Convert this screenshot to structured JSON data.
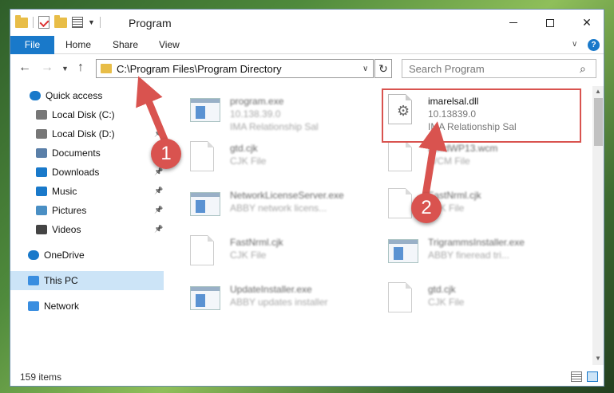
{
  "window": {
    "title": "Program"
  },
  "controls": {
    "minimize": "—",
    "maximize": "☐",
    "close": "✕"
  },
  "ribbon": {
    "tabs": [
      "File",
      "Home",
      "Share",
      "View"
    ],
    "help": "?"
  },
  "navigation": {
    "address": "C:\\Program Files\\Program Directory",
    "search_placeholder": "Search Program"
  },
  "sidebar": {
    "items": [
      {
        "label": "Quick access",
        "icon": "star-icon",
        "pinned": false
      },
      {
        "label": "Local Disk (C:)",
        "icon": "drive-icon",
        "pinned": false
      },
      {
        "label": "Local Disk (D:)",
        "icon": "drive-icon",
        "pinned": true
      },
      {
        "label": "Documents",
        "icon": "documents-icon",
        "pinned": true
      },
      {
        "label": "Downloads",
        "icon": "download-icon",
        "pinned": true
      },
      {
        "label": "Music",
        "icon": "music-icon",
        "pinned": true
      },
      {
        "label": "Pictures",
        "icon": "pictures-icon",
        "pinned": true
      },
      {
        "label": "Videos",
        "icon": "videos-icon",
        "pinned": true
      },
      {
        "label": "OneDrive",
        "icon": "cloud-icon",
        "pinned": false
      },
      {
        "label": "This PC",
        "icon": "computer-icon",
        "pinned": false,
        "selected": true
      },
      {
        "label": "Network",
        "icon": "network-icon",
        "pinned": false
      }
    ]
  },
  "files": [
    {
      "name": "program.exe",
      "line2": "10.138.39.0",
      "line3": "IMA Relationship Sal",
      "kind": "exe",
      "blurred": true
    },
    {
      "name": "imarelsal.dll",
      "line2": "10.13839.0",
      "line3": "IMA Relationship Sal",
      "kind": "dll",
      "blurred": false,
      "highlighted": true
    },
    {
      "name": "gtd.cjk",
      "line2": "CJK File",
      "line3": "",
      "kind": "doc",
      "blurred": true
    },
    {
      "name": "BuildWP13.wcm",
      "line2": "WCM File",
      "line3": "",
      "kind": "doc",
      "blurred": true
    },
    {
      "name": "NetworkLicenseServer.exe",
      "line2": "ABBY network licens...",
      "line3": "",
      "kind": "exe",
      "blurred": true
    },
    {
      "name": "FastNrml.cjk",
      "line2": "CJK File",
      "line3": "",
      "kind": "doc",
      "blurred": true
    },
    {
      "name": "FastNrml.cjk",
      "line2": "CJK File",
      "line3": "",
      "kind": "doc",
      "blurred": true
    },
    {
      "name": "TrigrammsInstaller.exe",
      "line2": "ABBY fineread tri...",
      "line3": "",
      "kind": "exe",
      "blurred": true
    },
    {
      "name": "UpdateInstaller.exe",
      "line2": "ABBY updates installer",
      "line3": "",
      "kind": "exe",
      "blurred": true
    },
    {
      "name": "gtd.cjk",
      "line2": "CJK File",
      "line3": "",
      "kind": "doc",
      "blurred": true
    }
  ],
  "status": {
    "count": "159 items"
  },
  "annotations": {
    "marker1": "1",
    "marker2": "2"
  },
  "colors": {
    "accent": "#1979ca",
    "annotation": "#d9534f",
    "selection": "#cce4f7"
  }
}
